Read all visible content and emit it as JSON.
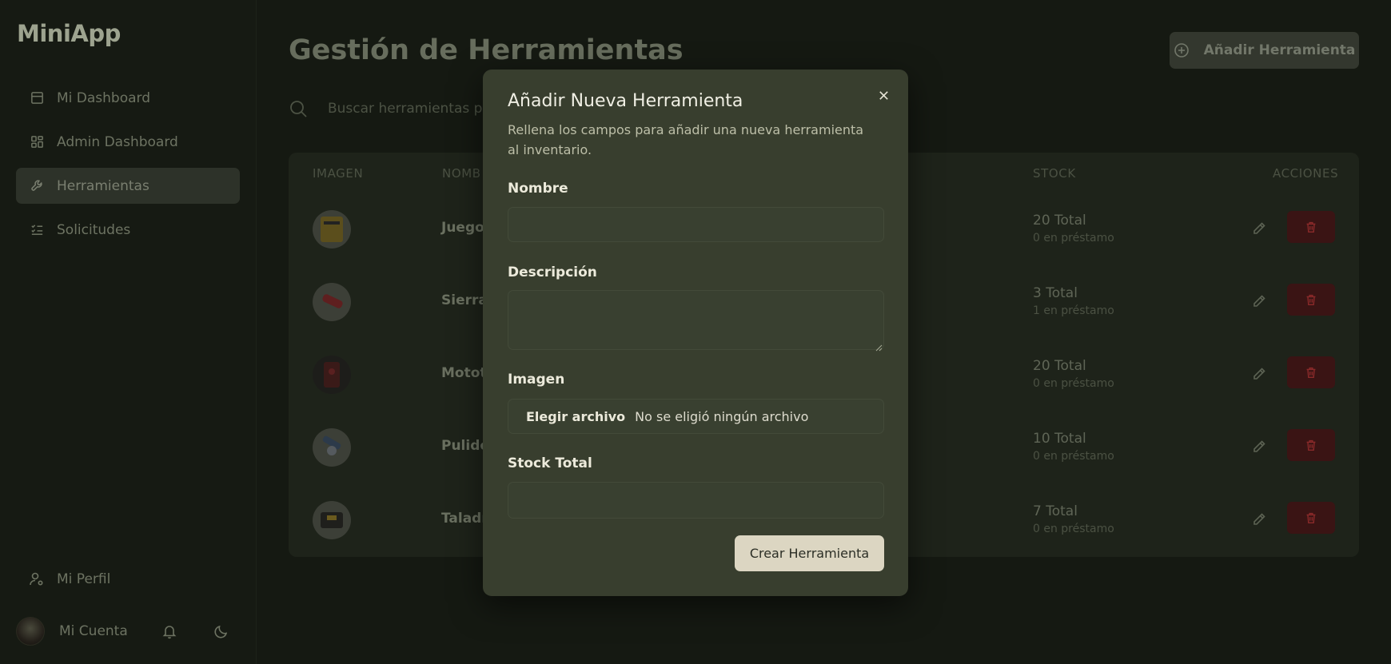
{
  "sidebar": {
    "logo": "MiniApp",
    "items": [
      {
        "label": "Mi Dashboard",
        "icon": "calendar-icon"
      },
      {
        "label": "Admin Dashboard",
        "icon": "grid-icon"
      },
      {
        "label": "Herramientas",
        "icon": "wrench-icon",
        "active": true
      },
      {
        "label": "Solicitudes",
        "icon": "checklist-icon"
      }
    ],
    "profile_label": "Mi Perfil",
    "account_label": "Mi Cuenta"
  },
  "header": {
    "title": "Gestión de Herramientas",
    "add_button_label": "Añadir Herramienta"
  },
  "search": {
    "placeholder": "Buscar herramientas por"
  },
  "table": {
    "columns": {
      "image": "IMAGEN",
      "name": "NOMB",
      "stock": "STOCK",
      "actions": "ACCIONES"
    },
    "rows": [
      {
        "name": "Juego",
        "stock": "20 Total",
        "loan": "0 en préstamo"
      },
      {
        "name": "Sierra",
        "stock": "3 Total",
        "loan": "1 en préstamo"
      },
      {
        "name": "Motot",
        "stock": "20 Total",
        "loan": "0 en préstamo"
      },
      {
        "name": "Pulido",
        "stock": "10 Total",
        "loan": "0 en préstamo"
      },
      {
        "name": "Taladr",
        "stock": "7 Total",
        "loan": "0 en préstamo"
      }
    ]
  },
  "modal": {
    "title": "Añadir Nueva Herramienta",
    "description": "Rellena los campos para añadir una nueva herramienta al inventario.",
    "fields": {
      "name_label": "Nombre",
      "description_label": "Descripción",
      "image_label": "Imagen",
      "file_button": "Elegir archivo",
      "file_status": "No se eligió ningún archivo",
      "stock_label": "Stock Total"
    },
    "submit_label": "Crear Herramienta"
  },
  "colors": {
    "modal_bg": "#383e2e",
    "submit_bg": "#dcd6c2",
    "delete_bg": "#3a1414"
  }
}
